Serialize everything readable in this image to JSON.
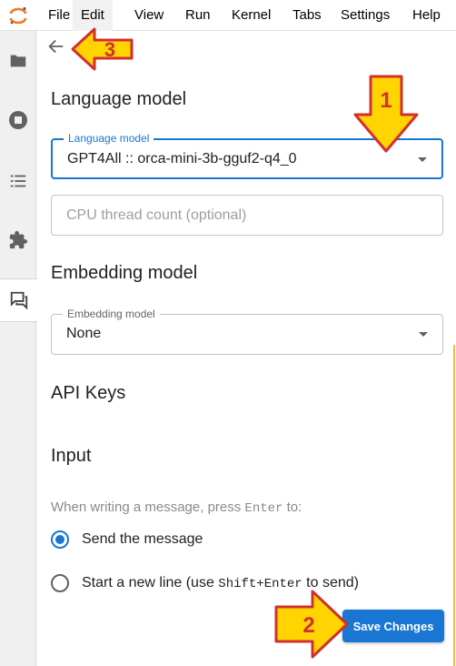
{
  "menu": {
    "items": [
      "File",
      "Edit",
      "View",
      "Run",
      "Kernel",
      "Tabs",
      "Settings",
      "Help"
    ]
  },
  "sidebar": {
    "icons": [
      "folder-icon",
      "stop-circle-icon",
      "list-icon",
      "extension-icon",
      "chat-icon"
    ],
    "active": "chat-icon"
  },
  "language_model": {
    "heading": "Language model",
    "label": "Language model",
    "value": "GPT4All :: orca-mini-3b-gguf2-q4_0",
    "cpu_placeholder": "CPU thread count (optional)"
  },
  "embedding_model": {
    "heading": "Embedding model",
    "label": "Embedding model",
    "value": "None"
  },
  "api_keys": {
    "heading": "API Keys"
  },
  "input": {
    "heading": "Input",
    "hint_prefix": "When writing a message, press ",
    "hint_key": "Enter",
    "hint_suffix": " to:",
    "option_send": "Send the message",
    "option_newline_prefix": "Start a new line (use ",
    "option_newline_key": "Shift+Enter",
    "option_newline_suffix": " to send)",
    "selected": "send"
  },
  "save_button": "Save Changes",
  "callouts": [
    "1",
    "2",
    "3"
  ],
  "colors": {
    "accent": "#1976d2",
    "callout_fill": "#ffd400",
    "callout_stroke": "#d32f2f"
  }
}
